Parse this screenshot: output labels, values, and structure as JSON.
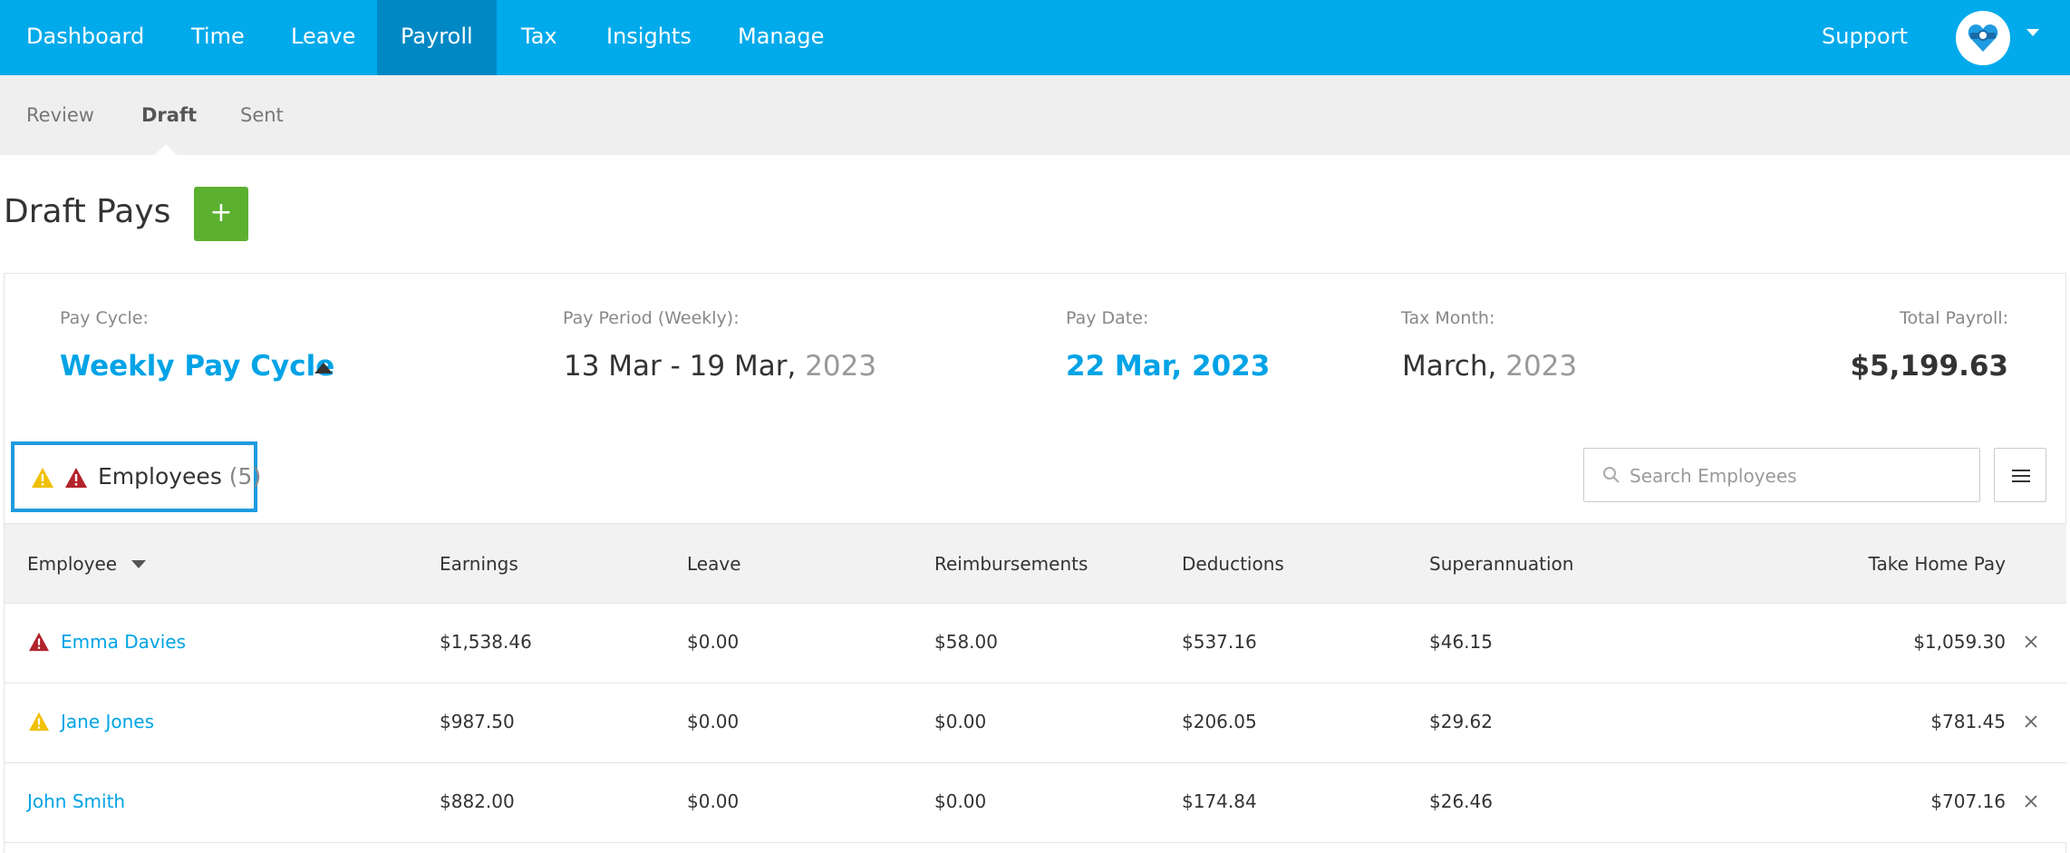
{
  "nav": {
    "items": [
      "Dashboard",
      "Time",
      "Leave",
      "Payroll",
      "Tax",
      "Insights",
      "Manage"
    ],
    "active": "Payroll",
    "support": "Support"
  },
  "subnav": {
    "items": [
      "Review",
      "Draft",
      "Sent"
    ],
    "active": "Draft"
  },
  "page": {
    "title": "Draft Pays",
    "add_label": "+"
  },
  "summary": {
    "pay_cycle_label": "Pay Cycle:",
    "pay_cycle_value": "Weekly Pay Cycle",
    "pay_period_label": "Pay Period (Weekly):",
    "pay_period_value": "13 Mar - 19 Mar,",
    "pay_period_year": "2023",
    "pay_date_label": "Pay Date:",
    "pay_date_value": "22 Mar, 2023",
    "tax_month_label": "Tax Month:",
    "tax_month_value": "March,",
    "tax_month_year": "2023",
    "total_label": "Total Payroll:",
    "total_value": "$5,199.63"
  },
  "employees": {
    "label": "Employees",
    "count": "(5)",
    "search_placeholder": "Search Employees"
  },
  "table": {
    "columns": [
      "Employee",
      "Earnings",
      "Leave",
      "Reimbursements",
      "Deductions",
      "Superannuation",
      "Take Home Pay"
    ],
    "rows": [
      {
        "warning": "error",
        "name": "Emma Davies",
        "earnings": "$1,538.46",
        "leave": "$0.00",
        "reimbursements": "$58.00",
        "deductions": "$537.16",
        "super": "$46.15",
        "take_home": "$1,059.30"
      },
      {
        "warning": "warning",
        "name": "Jane Jones",
        "earnings": "$987.50",
        "leave": "$0.00",
        "reimbursements": "$0.00",
        "deductions": "$206.05",
        "super": "$29.62",
        "take_home": "$781.45"
      },
      {
        "warning": "none",
        "name": "John Smith",
        "earnings": "$882.00",
        "leave": "$0.00",
        "reimbursements": "$0.00",
        "deductions": "$174.84",
        "super": "$26.46",
        "take_home": "$707.16"
      }
    ]
  },
  "colors": {
    "nav_bg": "#00aaeb",
    "nav_active": "#0088c4",
    "link": "#00a3e6",
    "add_button": "#5bb030",
    "warning_yellow": "#f0c000",
    "error_red": "#b3232b",
    "highlight_border": "#1e9be0"
  },
  "icons": {
    "avatar": "heart-lock-icon",
    "warning": "warning-triangle-icon",
    "error": "error-triangle-icon",
    "search": "search-icon",
    "menu": "hamburger-menu-icon",
    "remove": "close-icon"
  }
}
